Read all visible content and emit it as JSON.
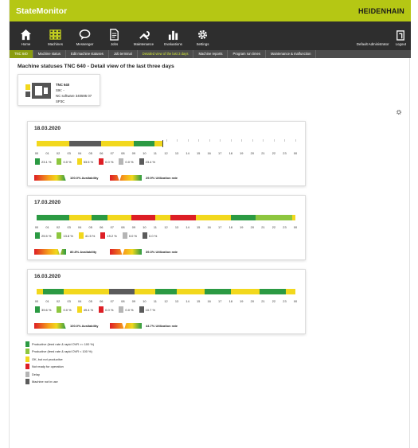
{
  "app": {
    "title": "StateMonitor",
    "brand": "HEIDENHAIN"
  },
  "nav": {
    "items": [
      {
        "label": "Home",
        "icon": "home-icon"
      },
      {
        "label": "Machines",
        "icon": "machines-grid-icon"
      },
      {
        "label": "Messenger",
        "icon": "speech-bubble-icon"
      },
      {
        "label": "Jobs",
        "icon": "document-icon"
      },
      {
        "label": "Maintenance",
        "icon": "wrench-icon"
      },
      {
        "label": "Evaluations",
        "icon": "bar-chart-icon"
      },
      {
        "label": "Settings",
        "icon": "gear-icon"
      }
    ],
    "user": "Default Administrator",
    "logout": "Logout"
  },
  "subnav": {
    "tabs": [
      {
        "label": "TNC 640",
        "state": "selected"
      },
      {
        "label": "Machine status",
        "state": "normal"
      },
      {
        "label": "Edit machine statuses",
        "state": "normal"
      },
      {
        "label": "Job terminal",
        "state": "normal"
      },
      {
        "label": "Detailed view of the last 3 days",
        "state": "highlighted"
      },
      {
        "label": "Machine reports",
        "state": "normal"
      },
      {
        "label": "Program run times",
        "state": "normal"
      },
      {
        "label": "Maintenance & malfunction",
        "state": "normal"
      }
    ]
  },
  "page": {
    "title": "Machine statuses TNC 640 - Detail view of the last three days"
  },
  "machine": {
    "name": "TNC 640",
    "sik_label": "SIK:",
    "sik_value": "-",
    "nc_label": "NC software",
    "nc_value": "340595 07 SP3C"
  },
  "colors": {
    "productive": "#2b9a43",
    "productive_reduced": "#8dc63f",
    "ok_not_productive": "#f2d81d",
    "not_ready": "#dd1e25",
    "delay": "#b5b5b5",
    "not_in_use": "#5b5b5b"
  },
  "hours": [
    "00",
    "01",
    "02",
    "03",
    "04",
    "05",
    "06",
    "07",
    "08",
    "09",
    "10",
    "11",
    "12",
    "13",
    "14",
    "15",
    "16",
    "17",
    "18",
    "19",
    "20",
    "21",
    "22",
    "23",
    "00"
  ],
  "days": [
    {
      "date": "18.03.2020",
      "timeline": [
        {
          "start": 0.0,
          "end": 3.0,
          "state": "ok_not_productive"
        },
        {
          "start": 3.0,
          "end": 6.0,
          "state": "not_in_use"
        },
        {
          "start": 6.0,
          "end": 9.0,
          "state": "ok_not_productive"
        },
        {
          "start": 9.0,
          "end": 10.9,
          "state": "productive"
        },
        {
          "start": 10.9,
          "end": 11.65,
          "state": "ok_not_productive"
        }
      ],
      "now_hour": 11.65,
      "stats": [
        {
          "state": "productive",
          "value": "23.1 %"
        },
        {
          "state": "productive_reduced",
          "value": "0.0 %"
        },
        {
          "state": "ok_not_productive",
          "value": "53.5 %"
        },
        {
          "state": "not_ready",
          "value": "0.0 %"
        },
        {
          "state": "delay",
          "value": "0.0 %"
        },
        {
          "state": "not_in_use",
          "value": "23.4 %"
        }
      ],
      "availability": {
        "percent": 100.0,
        "label": "100.0% Availability"
      },
      "utilization": {
        "percent": 29.9,
        "label": "29.9% Utilization rate"
      }
    },
    {
      "date": "17.03.2020",
      "timeline": [
        {
          "start": 0.0,
          "end": 3.0,
          "state": "productive"
        },
        {
          "start": 3.0,
          "end": 5.1,
          "state": "ok_not_productive"
        },
        {
          "start": 5.1,
          "end": 6.6,
          "state": "productive"
        },
        {
          "start": 6.6,
          "end": 8.8,
          "state": "ok_not_productive"
        },
        {
          "start": 8.8,
          "end": 11.0,
          "state": "not_ready"
        },
        {
          "start": 11.0,
          "end": 12.4,
          "state": "ok_not_productive"
        },
        {
          "start": 12.4,
          "end": 14.8,
          "state": "not_ready"
        },
        {
          "start": 14.8,
          "end": 18.0,
          "state": "ok_not_productive"
        },
        {
          "start": 18.0,
          "end": 20.3,
          "state": "productive"
        },
        {
          "start": 20.3,
          "end": 23.7,
          "state": "productive_reduced"
        },
        {
          "start": 23.7,
          "end": 24.0,
          "state": "ok_not_productive"
        }
      ],
      "stats": [
        {
          "state": "productive",
          "value": "25.5 %"
        },
        {
          "state": "productive_reduced",
          "value": "13.8 %"
        },
        {
          "state": "ok_not_productive",
          "value": "41.5 %"
        },
        {
          "state": "not_ready",
          "value": "19.2 %"
        },
        {
          "state": "delay",
          "value": "0.0 %"
        },
        {
          "state": "not_in_use",
          "value": "0.0 %"
        }
      ],
      "availability": {
        "percent": 80.8,
        "label": "80.8% Availability"
      },
      "utilization": {
        "percent": 39.3,
        "label": "39.3% Utilization rate"
      }
    },
    {
      "date": "16.03.2020",
      "timeline": [
        {
          "start": 0.0,
          "end": 0.6,
          "state": "ok_not_productive"
        },
        {
          "start": 0.6,
          "end": 2.5,
          "state": "productive"
        },
        {
          "start": 2.5,
          "end": 6.7,
          "state": "ok_not_productive"
        },
        {
          "start": 6.7,
          "end": 9.1,
          "state": "not_in_use"
        },
        {
          "start": 9.1,
          "end": 11.0,
          "state": "ok_not_productive"
        },
        {
          "start": 11.0,
          "end": 13.0,
          "state": "productive"
        },
        {
          "start": 13.0,
          "end": 15.6,
          "state": "ok_not_productive"
        },
        {
          "start": 15.6,
          "end": 18.0,
          "state": "productive"
        },
        {
          "start": 18.0,
          "end": 20.7,
          "state": "ok_not_productive"
        },
        {
          "start": 20.7,
          "end": 23.1,
          "state": "productive"
        },
        {
          "start": 23.1,
          "end": 24.0,
          "state": "ok_not_productive"
        }
      ],
      "stats": [
        {
          "state": "productive",
          "value": "39.6 %"
        },
        {
          "state": "productive_reduced",
          "value": "0.0 %"
        },
        {
          "state": "ok_not_productive",
          "value": "49.4 %"
        },
        {
          "state": "not_ready",
          "value": "0.0 %"
        },
        {
          "state": "delay",
          "value": "0.0 %"
        },
        {
          "state": "not_in_use",
          "value": "10.7 %"
        }
      ],
      "availability": {
        "percent": 100.0,
        "label": "100.0% Availability"
      },
      "utilization": {
        "percent": 44.7,
        "label": "44.7% Utilization rate"
      }
    }
  ],
  "legend": [
    {
      "state": "productive",
      "label": "Productive (feed rate & rapid OVR >= 100 %)"
    },
    {
      "state": "productive_reduced",
      "label": "Productive (feed rate & rapid OVR < 100 %)"
    },
    {
      "state": "ok_not_productive",
      "label": "OK, but not productive"
    },
    {
      "state": "not_ready",
      "label": "Not ready for operation"
    },
    {
      "state": "delay",
      "label": "Delay"
    },
    {
      "state": "not_in_use",
      "label": "Machine not in use"
    }
  ]
}
